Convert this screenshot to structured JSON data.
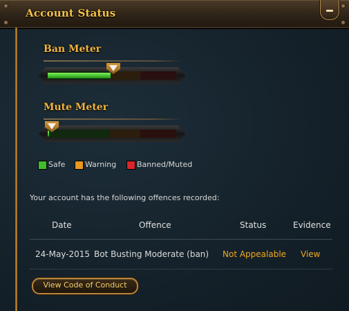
{
  "header": {
    "title": "Account Status"
  },
  "meters": [
    {
      "title": "Ban Meter",
      "level_percent": 49
    },
    {
      "title": "Mute Meter",
      "level_percent": 1
    }
  ],
  "legend": [
    {
      "label": "Safe",
      "color": "#3fbf2c"
    },
    {
      "label": "Warning",
      "color": "#e89a1e"
    },
    {
      "label": "Banned/Muted",
      "color": "#d8262a"
    }
  ],
  "offences": {
    "intro": "Your account has the following offences recorded:",
    "columns": [
      "Date",
      "Offence",
      "Status",
      "Evidence"
    ],
    "rows": [
      {
        "date": "24-May-2015",
        "offence": "Bot Busting Moderate (ban)",
        "status": "Not Appealable",
        "evidence": "View"
      }
    ]
  },
  "conduct_button": "View Code of Conduct",
  "colors": {
    "accent_gold": "#f0a91f",
    "title_gold": "#f3c24a"
  }
}
